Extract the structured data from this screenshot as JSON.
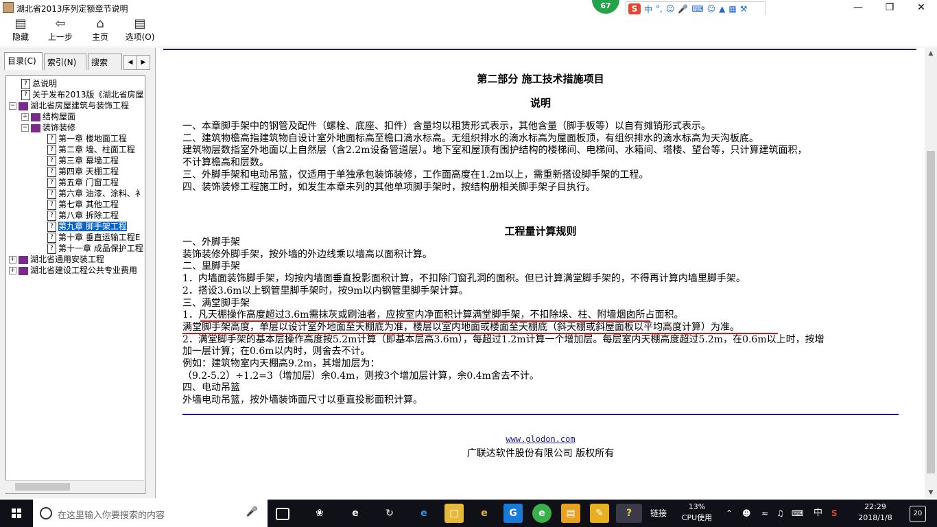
{
  "window": {
    "title": "湖北省2013序列定额章节说明"
  },
  "overlay": {
    "badge": "67",
    "ime_s": "S",
    "ime_lang": "中",
    "ime_punct": "°,"
  },
  "toolbar": {
    "hide": "隐藏",
    "back": "上一步",
    "home": "主页",
    "options": "选项(O)"
  },
  "tabs": {
    "contents": "目录(C)",
    "index": "索引(N)",
    "search": "搜索(S)"
  },
  "tree": [
    {
      "label": "总说明",
      "level": 1,
      "icon": "q"
    },
    {
      "label": "关于发布2013版《湖北省房屋",
      "level": 1,
      "icon": "q"
    },
    {
      "label": "湖北省房屋建筑与装饰工程",
      "level": 0,
      "icon": "book",
      "exp": "minus"
    },
    {
      "label": "结构屋面",
      "level": 1,
      "icon": "book",
      "exp": "plus"
    },
    {
      "label": "装饰装修",
      "level": 1,
      "icon": "book",
      "exp": "minus"
    },
    {
      "label": "第一章 楼地面工程",
      "level": 2,
      "icon": "q"
    },
    {
      "label": "第二章 墙、柱面工程",
      "level": 2,
      "icon": "q"
    },
    {
      "label": "第三章 幕墙工程",
      "level": 2,
      "icon": "q"
    },
    {
      "label": "第四章 天棚工程",
      "level": 2,
      "icon": "q"
    },
    {
      "label": "第五章 门窗工程",
      "level": 2,
      "icon": "q"
    },
    {
      "label": "第六章 油漆、涂料、衤",
      "level": 2,
      "icon": "q"
    },
    {
      "label": "第七章 其他工程",
      "level": 2,
      "icon": "q"
    },
    {
      "label": "第八章 拆除工程",
      "level": 2,
      "icon": "q"
    },
    {
      "label": "第九章 脚手架工程",
      "level": 2,
      "icon": "q",
      "selected": true
    },
    {
      "label": "第十章 垂直运输工程E",
      "level": 2,
      "icon": "q"
    },
    {
      "label": "第十一章 成品保护工程",
      "level": 2,
      "icon": "q"
    },
    {
      "label": "湖北省通用安装工程",
      "level": 0,
      "icon": "book",
      "exp": "plus"
    },
    {
      "label": "湖北省建设工程公共专业费用",
      "level": 0,
      "icon": "book",
      "exp": "plus"
    }
  ],
  "doc": {
    "part_title": "第二部分 施工技术措施项目",
    "section1_title": "说明",
    "section1_lines": [
      "一、本章脚手架中的钢管及配件（螺栓、底座、扣件）含量均以租赁形式表示，其他含量（脚手板等）以自有摊销形式表示。",
      "二、建筑物檐高指建筑物自设计室外地面标高至檐口滴水标高。无组织排水的滴水标高为屋面板顶，有组织排水的滴水标高为天沟板底。",
      "建筑物层数指室外地面以上自然层（含2.2m设备管道层）。地下室和屋顶有围护结构的楼梯间、电梯间、水箱间、塔楼、望台等，只计算建筑面积，",
      "不计算檐高和层数。",
      "三、外脚手架和电动吊篮，仅适用于单独承包装饰装修，工作面高度在1.2m以上，需重新搭设脚手架的工程。",
      "四、装饰装修工程施工时，如发生本章未列的其他单项脚手架时，按结构册相关脚手架子目执行。"
    ],
    "section2_title": "工程量计算规则",
    "section2_lines": [
      "一、外脚手架",
      "装饰装修外脚手架，按外墙的外边线乘以墙高以面积计算。",
      "二、里脚手架",
      "1．内墙面装饰脚手架，均按内墙面垂直投影面积计算，不扣除门窗孔洞的面积。但已计算满堂脚手架的，不得再计算内墙里脚手架。",
      "2．搭设3.6m以上钢管里脚手架时，按9m以内钢管里脚手架计算。",
      "三、满堂脚手架",
      "1．凡天棚操作高度超过3.6m需抹灰或刷油者，应按室内净面积计算满堂脚手架，不扣除垛、柱、附墙烟囱所占面积。",
      "满堂脚手架高度，单层以设计室外地面至天棚底为准，楼层以室内地面或楼面至天棚底（斜天棚或斜屋面板以平均高度计算）为准。",
      "2．满堂脚手架的基本层操作高度按5.2m计算（即基本层高3.6m），每超过1.2m计算一个增加层。每层室内天棚高度超过5.2m，在0.6m以上时，按增",
      "加一层计算；在0.6m以内时，则舍去不计。",
      "例如：建筑物室内天棚高9.2m，其增加层为：",
      "（9.2-5.2）÷1.2=3（增加层）余0.4m，则按3个增加层计算，余0.4m舍去不计。",
      "四、电动吊篮",
      "外墙电动吊篮，按外墙装饰面尺寸以垂直投影面积计算。"
    ],
    "footer_link": "www.glodon.com",
    "footer_copy": "广联达软件股份有限公司 版权所有"
  },
  "taskbar": {
    "search_placeholder": "在这里输入你要搜索的内容",
    "links_label": "链接",
    "cpu_percent": "13%",
    "cpu_label": "CPU使用",
    "ime": "中",
    "time": "22:29",
    "date": "2018/1/8",
    "notifications": "20"
  },
  "colors": {
    "accent_blue": "#1a1aa0",
    "underline_red": "#e01010",
    "selection": "#0a64c8"
  }
}
